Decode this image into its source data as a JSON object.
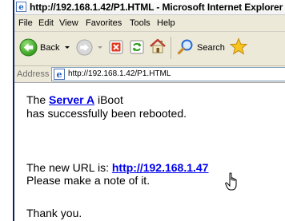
{
  "window": {
    "title": "http://192.168.1.42/P1.HTML - Microsoft Internet Explorer"
  },
  "menu": [
    "File",
    "Edit",
    "View",
    "Favorites",
    "Tools",
    "Help"
  ],
  "toolbar": {
    "back_label": "Back",
    "search_label": "Search"
  },
  "address": {
    "label": "Address",
    "url": "http://192.168.1.42/P1.HTML"
  },
  "page": {
    "line1_prefix": "The ",
    "server_link": "Server A",
    "line1_suffix": " iBoot",
    "line2": "has successfully been rebooted.",
    "line3_prefix": "The new URL is: ",
    "new_url": "http://192.168.1.47",
    "line4": "Please make a note of it.",
    "line5": "Thank you."
  }
}
